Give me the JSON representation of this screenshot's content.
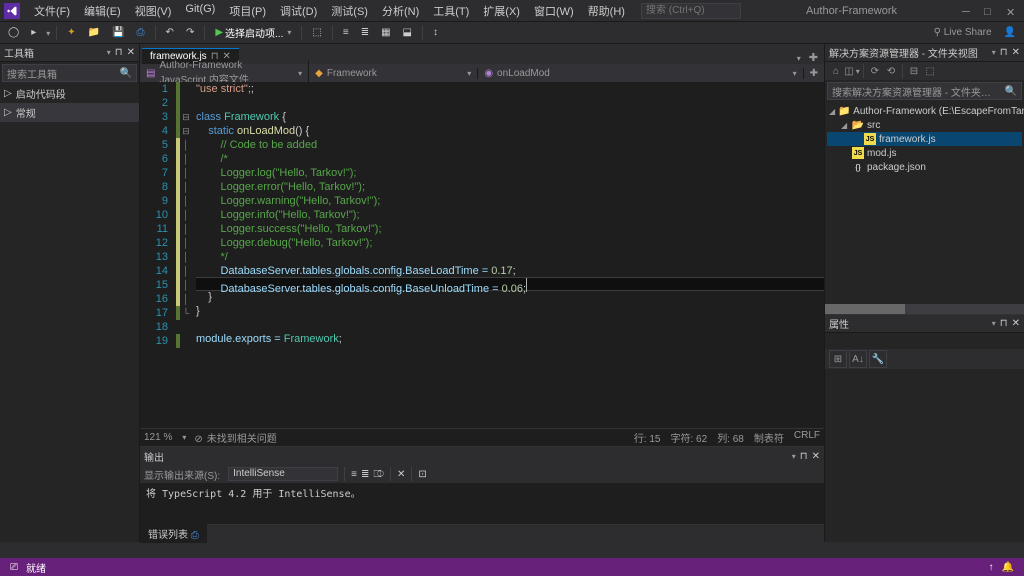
{
  "title": "Author-Framework",
  "menu": {
    "file": "文件(F)",
    "edit": "编辑(E)",
    "view": "视图(V)",
    "git": "Git(G)",
    "project": "项目(P)",
    "debug": "调试(D)",
    "test": "测试(S)",
    "analyze": "分析(N)",
    "tools": "工具(T)",
    "extensions": "扩展(X)",
    "window": "窗口(W)",
    "help": "帮助(H)"
  },
  "search_placeholder": "搜索 (Ctrl+Q)",
  "toolbar": {
    "run": "选择启动项..."
  },
  "live_share": "Live Share",
  "toolbox": {
    "title": "工具箱",
    "search": "搜索工具箱",
    "items": [
      "启动代码段",
      "常规"
    ]
  },
  "tab": {
    "name": "framework.js"
  },
  "breadcrumb": {
    "b1": "Author-Framework JavaScript 内容文件",
    "b2": "Framework",
    "b3": "onLoadMod"
  },
  "code": {
    "lines": [
      {
        "n": 1,
        "chg": "saved"
      },
      {
        "n": 2,
        "chg": "saved"
      },
      {
        "n": 3,
        "chg": "saved"
      },
      {
        "n": 4,
        "chg": "saved"
      },
      {
        "n": 5,
        "chg": "unsaved"
      },
      {
        "n": 6,
        "chg": "unsaved"
      },
      {
        "n": 7,
        "chg": "unsaved"
      },
      {
        "n": 8,
        "chg": "unsaved"
      },
      {
        "n": 9,
        "chg": "unsaved"
      },
      {
        "n": 10,
        "chg": "unsaved"
      },
      {
        "n": 11,
        "chg": "unsaved"
      },
      {
        "n": 12,
        "chg": "unsaved"
      },
      {
        "n": 13,
        "chg": "unsaved"
      },
      {
        "n": 14,
        "chg": "unsaved"
      },
      {
        "n": 15,
        "chg": "unsaved"
      },
      {
        "n": 16,
        "chg": "unsaved"
      },
      {
        "n": 17,
        "chg": "saved"
      },
      {
        "n": 18,
        "chg": ""
      },
      {
        "n": 19,
        "chg": "saved"
      }
    ],
    "l1": "\"use strict\";",
    "l3_kw": "class",
    "l3_cls": "Framework",
    "l4_kw": "static",
    "l4_fn": "onLoadMod",
    "l5_cmt": "// Code to be added",
    "l6_cmt": "/*",
    "l7": "Logger.log(\"Hello, Tarkov!\");",
    "l8": "Logger.error(\"Hello, Tarkov!\");",
    "l9": "Logger.warning(\"Hello, Tarkov!\");",
    "l10": "Logger.info(\"Hello, Tarkov!\");",
    "l11": "Logger.success(\"Hello, Tarkov!\");",
    "l12": "Logger.debug(\"Hello, Tarkov!\");",
    "l13_cmt": "*/",
    "l14_a": "DatabaseServer.tables.globals.config.BaseLoadTime = ",
    "l14_b": "0.17",
    "l15_a": "DatabaseServer.tables.globals.config.BaseUnloadTime = ",
    "l15_b": "0.06",
    "l19_a": "module.exports = ",
    "l19_b": "Framework"
  },
  "editor_status": {
    "zoom": "121 %",
    "no_issues": "未找到相关问题",
    "line": "行: 15",
    "char": "字符: 62",
    "col": "列: 68",
    "tab": "制表符",
    "eol": "CRLF"
  },
  "output": {
    "title": "输出",
    "src_label": "显示输出来源(S):",
    "src_value": "IntelliSense",
    "content": "将 TypeScript 4.2 用于 IntelliSense。"
  },
  "bottom_tab": "错误列表",
  "solution": {
    "title": "解决方案资源管理器 - 文件夹视图",
    "search_placeholder": "搜索解决方案资源管理器 - 文件夹视图(Ctrl+;)",
    "root": "Author-Framework (E:\\EscapeFromTarkov\\user\\mc",
    "src": "src",
    "framework": "framework.js",
    "mod": "mod.js",
    "package": "package.json"
  },
  "properties": {
    "title": "属性"
  },
  "statusbar": {
    "ready": "就绪"
  }
}
